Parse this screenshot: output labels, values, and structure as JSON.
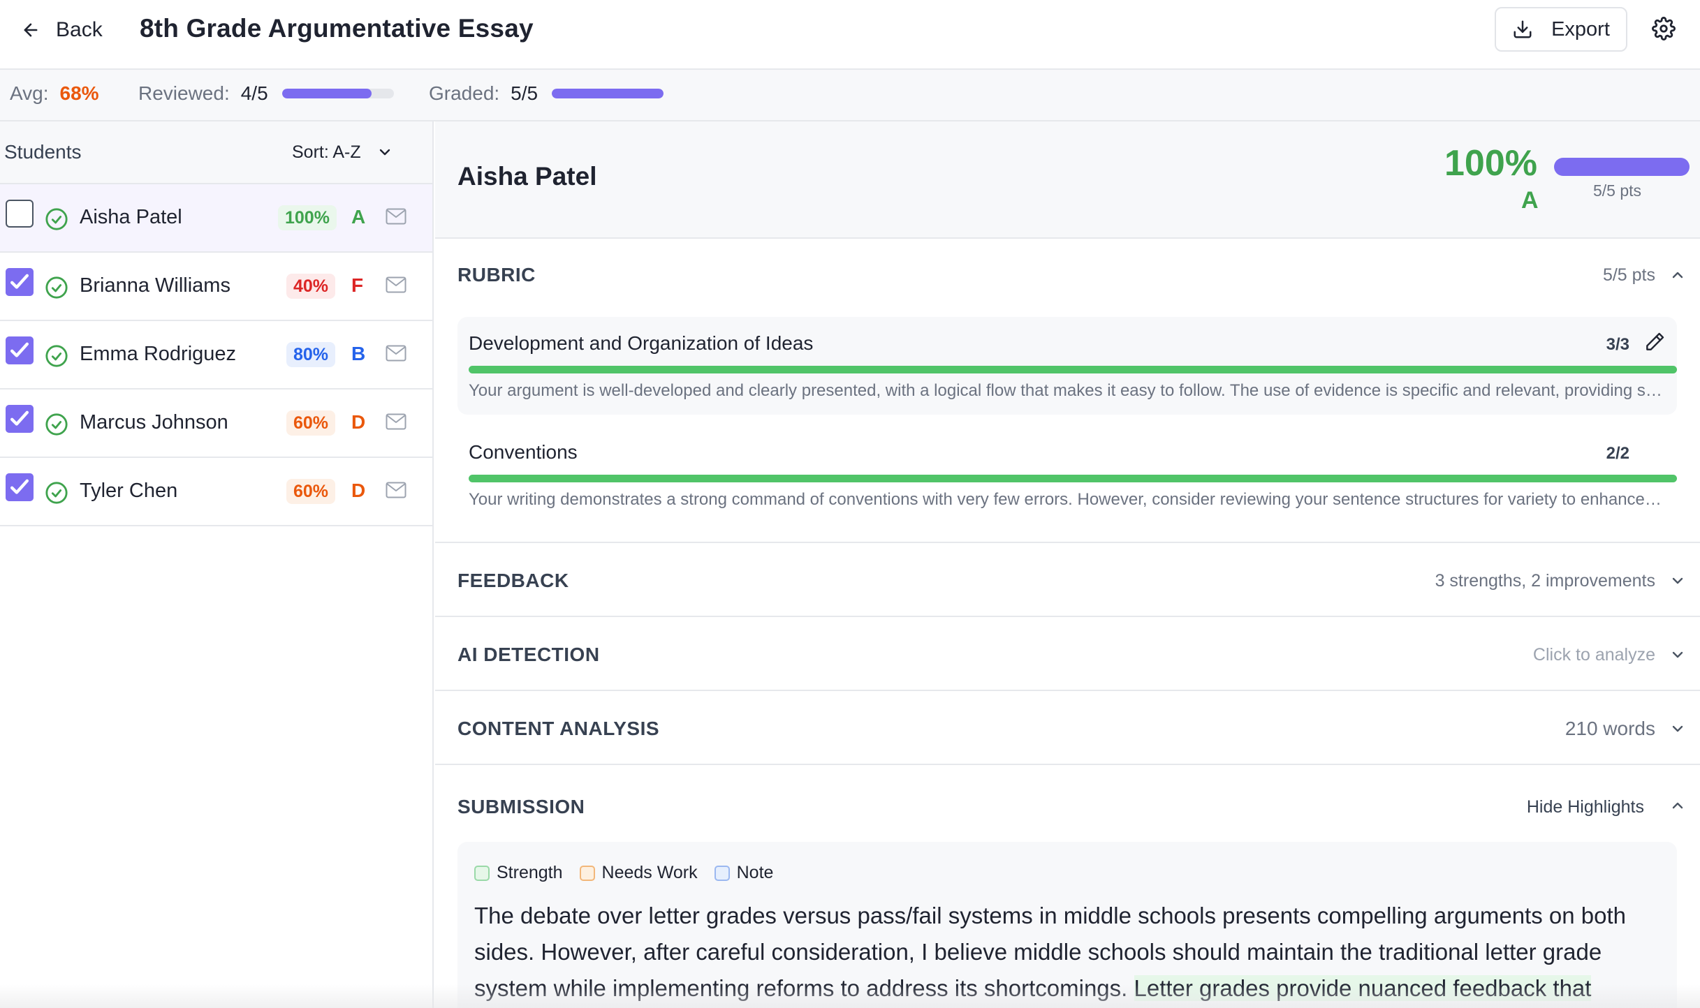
{
  "header": {
    "back_label": "Back",
    "title": "8th Grade Argumentative Essay",
    "export_label": "Export"
  },
  "stats": {
    "avg_label": "Avg:",
    "avg_value": "68%",
    "reviewed_label": "Reviewed:",
    "reviewed_value": "4/5",
    "reviewed_fraction": 0.8,
    "graded_label": "Graded:",
    "graded_value": "5/5",
    "graded_fraction": 1.0
  },
  "students_panel": {
    "title": "Students",
    "sort_label": "Sort: A-Z",
    "students": [
      {
        "name": "Aisha Patel",
        "percent": "100%",
        "grade": "A",
        "checked": false,
        "color": "#3fa34d",
        "bg": "#eaf7ec"
      },
      {
        "name": "Brianna Williams",
        "percent": "40%",
        "grade": "F",
        "checked": true,
        "color": "#dc2626",
        "bg": "#fdeaea"
      },
      {
        "name": "Emma Rodriguez",
        "percent": "80%",
        "grade": "B",
        "checked": true,
        "color": "#2563eb",
        "bg": "#e8effd"
      },
      {
        "name": "Marcus Johnson",
        "percent": "60%",
        "grade": "D",
        "checked": true,
        "color": "#ea580c",
        "bg": "#fdf0e6"
      },
      {
        "name": "Tyler Chen",
        "percent": "60%",
        "grade": "D",
        "checked": true,
        "color": "#ea580c",
        "bg": "#fdf0e6"
      }
    ]
  },
  "detail": {
    "student_name": "Aisha Patel",
    "percent": "100%",
    "grade": "A",
    "points_label": "5/5 pts",
    "points_fraction": 1.0,
    "rubric": {
      "title": "RUBRIC",
      "meta": "5/5 pts",
      "criteria": [
        {
          "name": "Development and Organization of Ideas",
          "score": "3/3",
          "fraction": 1.0,
          "comment": "Your argument is well-developed and clearly presented, with a logical flow that makes it easy to follow. The use of evidence is specific and relevant, providing strong support for your claims."
        },
        {
          "name": "Conventions",
          "score": "2/2",
          "fraction": 1.0,
          "comment": "Your writing demonstrates a strong command of conventions with very few errors. However, consider reviewing your sentence structures for variety to enhance readability."
        }
      ]
    },
    "feedback": {
      "title": "FEEDBACK",
      "meta": "3 strengths, 2 improvements"
    },
    "ai_detection": {
      "title": "AI DETECTION",
      "meta": "Click to analyze"
    },
    "content_analysis": {
      "title": "CONTENT ANALYSIS",
      "meta": "210 words"
    },
    "submission": {
      "title": "SUBMISSION",
      "toggle_label": "Hide Highlights",
      "legend": [
        {
          "label": "Strength",
          "color": "#e6f7e9",
          "border": "#9ad9a8"
        },
        {
          "label": "Needs Work",
          "color": "#fdf0e0",
          "border": "#f2b77a"
        },
        {
          "label": "Note",
          "color": "#e6effd",
          "border": "#9bb8f0"
        }
      ],
      "text_plain": "The debate over letter grades versus pass/fail systems in middle schools presents compelling arguments on both sides. However, after careful consideration, I believe middle schools should maintain the traditional letter grade system while implementing reforms to address its shortcomings.",
      "text_strength": "Letter grades provide nuanced feedback that pass/fail"
    }
  }
}
